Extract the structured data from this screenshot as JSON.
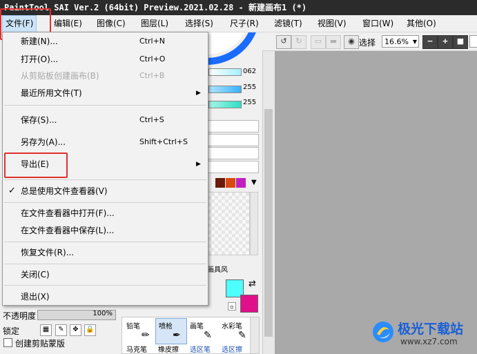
{
  "window": {
    "title": "PaintTool SAI Ver.2 (64bit) Preview.2021.02.28 - 新建画布1 (*)"
  },
  "menubar": {
    "items": [
      {
        "label": "文件(F)"
      },
      {
        "label": "编辑(E)"
      },
      {
        "label": "图像(C)"
      },
      {
        "label": "图层(L)"
      },
      {
        "label": "选择(S)"
      },
      {
        "label": "尺子(R)"
      },
      {
        "label": "滤镜(T)"
      },
      {
        "label": "视图(V)"
      },
      {
        "label": "窗口(W)"
      },
      {
        "label": "其他(O)"
      }
    ]
  },
  "toolbar": {
    "select_label": "选择",
    "zoom": "16.6%"
  },
  "file_menu": {
    "new": {
      "label": "新建(N)...",
      "shortcut": "Ctrl+N"
    },
    "open": {
      "label": "打开(O)...",
      "shortcut": "Ctrl+O"
    },
    "from_clipboard": {
      "label": "从剪贴板创建画布(B)",
      "shortcut": "Ctrl+B"
    },
    "recent": {
      "label": "最近所用文件(T)"
    },
    "save": {
      "label": "保存(S)...",
      "shortcut": "Ctrl+S"
    },
    "save_as": {
      "label": "另存为(A)...",
      "shortcut": "Shift+Ctrl+S"
    },
    "export": {
      "label": "导出(E)"
    },
    "always_use_viewer": {
      "label": "总是使用文件查看器(V)"
    },
    "open_in_viewer": {
      "label": "在文件查看器中打开(F)..."
    },
    "save_in_viewer": {
      "label": "在文件查看器中保存(L)..."
    },
    "recover": {
      "label": "恢复文件(R)..."
    },
    "close": {
      "label": "关闭(C)"
    },
    "exit": {
      "label": "退出(X)"
    }
  },
  "color_panel": {
    "slider_values": [
      "062",
      "255",
      "255"
    ],
    "panel_tab": "画具风"
  },
  "colors": {
    "foreground": "#4dffff",
    "background": "#e0108a",
    "highlight": "#e03030"
  },
  "layer_panel": {
    "opacity_label": "不透明度",
    "opacity_value": "100%",
    "opacity_fill": 1.0,
    "lock_label": "锁定",
    "clipping_label": "创建剪贴蒙版"
  },
  "tools": {
    "row1": [
      "铅笔",
      "喷枪",
      "画笔",
      "水彩笔"
    ],
    "row2": [
      "马克笔",
      "橡皮擦",
      "选区笔",
      "选区擦"
    ]
  },
  "watermark": {
    "text": "极光下载站",
    "url": "www.xz7.com"
  }
}
